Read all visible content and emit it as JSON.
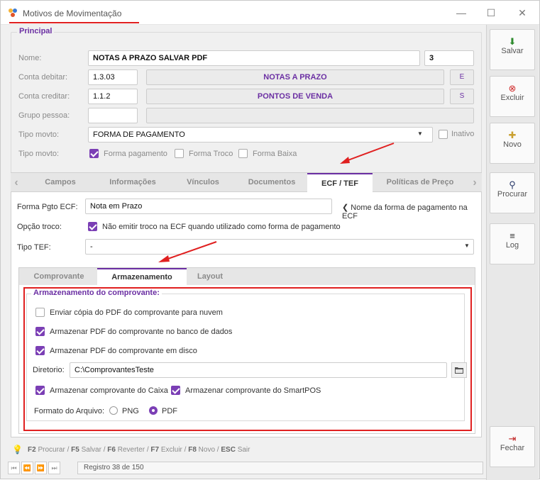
{
  "window": {
    "title": "Motivos de Movimentação",
    "minimize": "—",
    "maximize": "☐",
    "close": "✕"
  },
  "principal": {
    "title": "Principal",
    "nome": {
      "label": "Nome:",
      "value": "NOTAS A PRAZO SALVAR PDF",
      "code": "3"
    },
    "conta_debitar": {
      "label": "Conta debitar:",
      "value": "1.3.03",
      "desc": "NOTAS A PRAZO",
      "btn": "E"
    },
    "conta_creditar": {
      "label": "Conta creditar:",
      "value": "1.1.2",
      "desc": "PONTOS DE VENDA",
      "btn": "S"
    },
    "grupo_pessoa": {
      "label": "Grupo pessoa:",
      "value": "",
      "desc": ""
    },
    "tipo_movto": {
      "label": "Tipo movto:",
      "value": "FORMA DE PAGAMENTO",
      "inativo": "Inativo"
    },
    "tipo_movto2": {
      "label": "Tipo movto:",
      "forma_pagamento": "Forma pagamento",
      "forma_troco": "Forma Troco",
      "forma_baixa": "Forma Baixa"
    }
  },
  "tabs": [
    "Campos",
    "Informações",
    "Vínculos",
    "Documentos",
    "ECF / TEF",
    "Políticas de Preço"
  ],
  "tab_nav": {
    "left": "‹",
    "right": "›"
  },
  "ecf": {
    "forma_pgto": {
      "label": "Forma Pgto ECF:",
      "value": "Nota em Prazo",
      "hint": "❮ Nome da forma de pagamento na ECF"
    },
    "opcao_troco": {
      "label": "Opção troco:",
      "text": "Não emitir troco na ECF quando utilizado como forma de pagamento"
    },
    "tipo_tef": {
      "label": "Tipo TEF:",
      "value": "-"
    }
  },
  "subtabs": [
    "Comprovante",
    "Armazenamento",
    "Layout"
  ],
  "armazenamento": {
    "title": "Armazenamento do comprovante:",
    "enviar_nuvem": "Enviar cópia do PDF do comprovante para nuvem",
    "banco_dados": "Armazenar PDF do comprovante no banco de dados",
    "disco": "Armazenar PDF do comprovante em disco",
    "diretorio_label": "Diretorio:",
    "diretorio_value": "C:\\ComprovantesTeste",
    "caixa": "Armazenar comprovante do Caixa",
    "smartpos": "Armazenar comprovante do SmartPOS",
    "formato_label": "Formato do Arquivo:",
    "png": "PNG",
    "pdf": "PDF"
  },
  "status": {
    "registro": "Registro 38 de 150",
    "nav": [
      "⏮",
      "⏪",
      "⏩",
      "⏭"
    ]
  },
  "hint": {
    "k1": "F2",
    "t1": " Procurar / ",
    "k2": "F5",
    "t2": " Salvar / ",
    "k3": "F6",
    "t3": " Reverter / ",
    "k4": "F7",
    "t4": " Excluir / ",
    "k5": "F8",
    "t5": " Novo / ",
    "k6": "ESC",
    "t6": " Sair"
  },
  "sidebar": {
    "salvar": "Salvar",
    "excluir": "Excluir",
    "novo": "Novo",
    "procurar": "Procurar",
    "log": "Log",
    "fechar": "Fechar"
  },
  "colors": {
    "accent": "#6b2fa3",
    "annotation": "#e02020"
  }
}
